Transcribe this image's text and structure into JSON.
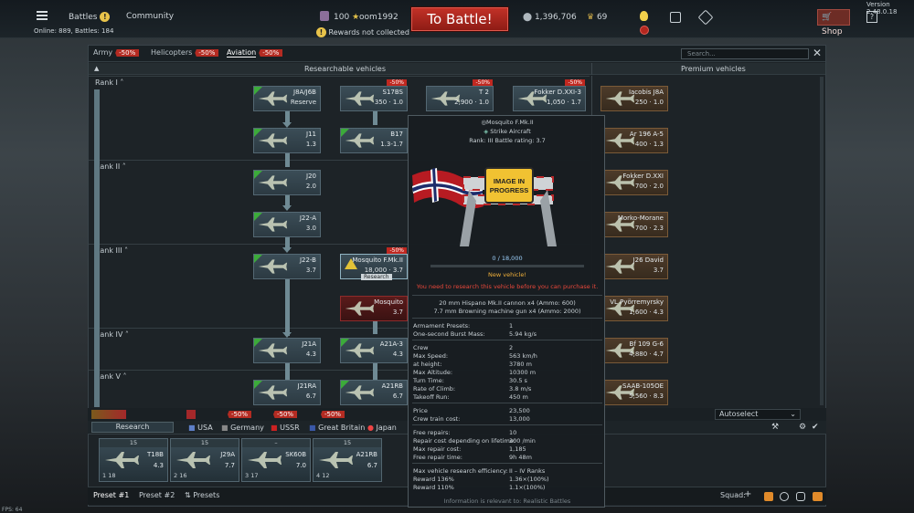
{
  "version": "Version 2.48.0.18",
  "topbar": {
    "battles": "Battles",
    "community": "Community",
    "online": "Online: 889, Battles: 184",
    "golden_eagles": "100",
    "username": "oom1992",
    "rewards_notice": "Rewards not collected",
    "to_battle": "To Battle!",
    "silver_lions": "1,396,706",
    "crew_level": "69",
    "shop": "Shop"
  },
  "tabs": [
    {
      "label": "Army",
      "discount": "-50%"
    },
    {
      "label": "Helicopters",
      "discount": "-50%"
    },
    {
      "label": "Aviation",
      "discount": "-50%"
    }
  ],
  "search_placeholder": "Search...",
  "section": {
    "researchable": "Researchable vehicles",
    "premium": "Premium vehicles"
  },
  "ranks": [
    "Rank I",
    "Rank II",
    "Rank III",
    "Rank IV",
    "Rank V"
  ],
  "tree": {
    "c1": [
      {
        "name": "J8A/J6B",
        "br": "Reserve"
      },
      {
        "name": "J11",
        "br": "1.3"
      },
      {
        "name": "J20",
        "br": "2.0"
      },
      {
        "name": "J22-A",
        "br": "3.0"
      },
      {
        "name": "J22-B",
        "br": "3.7"
      },
      {
        "name": "J21A",
        "br": "4.3"
      },
      {
        "name": "J21RA",
        "br": "6.7"
      }
    ],
    "c2": [
      {
        "name": "S17BS",
        "br": "350 · 1.0",
        "discount": "-50%"
      },
      {
        "name": "B17",
        "br": "1.3-1.7"
      },
      {
        "name": "Mosquito F.Mk.II",
        "br": "18,000 · 3.7",
        "discount": "-50%",
        "action": "Research"
      },
      {
        "name": "Mosquito",
        "br": "3.7"
      },
      {
        "name": "A21A-3",
        "br": "4.3"
      },
      {
        "name": "A21RB",
        "br": "6.7"
      }
    ],
    "c3": [
      {
        "name": "T 2",
        "br": "2,900 · 1.0",
        "discount": "-50%"
      },
      {
        "name": "Fokker D.XXI-3",
        "br": "1,050 · 1.7",
        "discount": "-50%"
      }
    ],
    "premium": [
      {
        "name": "Iacobis J8A",
        "br": "250 · 1.0"
      },
      {
        "name": "Ar 196 A-5",
        "br": "400 · 1.3"
      },
      {
        "name": "Fokker D.XXI",
        "br": "700 · 2.0"
      },
      {
        "name": "Morko-Morane",
        "br": "700 · 2.3"
      },
      {
        "name": "J26 David",
        "br": "3.7"
      },
      {
        "name": "VL Pyörremyrsky",
        "br": "1,600 · 4.3"
      },
      {
        "name": "Bf 109 G-6",
        "br": "4,880 · 4.7"
      },
      {
        "name": "SAAB-105OE",
        "br": "5,560 · 8.3"
      }
    ]
  },
  "tooltip": {
    "name": "Mosquito F.Mk.II",
    "role": "Strike Aircraft",
    "rank": "Rank: III",
    "battle_rating": "Battle rating: 3.7",
    "image_text": "IMAGE IN PROGRESS",
    "progress": "0 / 18,000",
    "progress_fraction": 0,
    "new_vehicle": "New vehicle!",
    "research_note": "You need to research this vehicle before you can purchase it.",
    "weapons": [
      "20 mm Hispano Mk.II cannon x4 (Ammo: 600)",
      "7.7 mm Browning machine gun x4 (Ammo: 2000)"
    ],
    "stats_a": [
      {
        "k": "Armament Presets:",
        "v": "1"
      },
      {
        "k": "One-second Burst Mass:",
        "v": "5.94 kg/s"
      }
    ],
    "stats_b": [
      {
        "k": "Crew",
        "v": "2"
      },
      {
        "k": "Max Speed:",
        "v": "563 km/h"
      },
      {
        "k": "at height:",
        "v": "3780 m"
      },
      {
        "k": "Max Altitude:",
        "v": "10300 m"
      },
      {
        "k": "Turn Time:",
        "v": "30.5 s"
      },
      {
        "k": "Rate of Climb:",
        "v": "3.8 m/s"
      },
      {
        "k": "Takeoff Run:",
        "v": "450 m"
      }
    ],
    "stats_c": [
      {
        "k": "Price",
        "v": "23,500"
      },
      {
        "k": "Crew train cost:",
        "v": "13,000"
      }
    ],
    "stats_d": [
      {
        "k": "Free repairs:",
        "v": "10"
      },
      {
        "k": "Repair cost depending on lifetime:",
        "v": "300 /min"
      },
      {
        "k": "Max repair cost:",
        "v": "1,185"
      },
      {
        "k": "Free repair time:",
        "v": "9h 48m"
      }
    ],
    "stats_e": [
      {
        "k": "Max vehicle research efficiency:",
        "v": "II – IV Ranks"
      },
      {
        "k": "Reward 136%",
        "v": "1.36×(100%)"
      },
      {
        "k": "Reward 110%",
        "v": "1.1×(100%)"
      }
    ],
    "footer": "Information is relevant to: Realistic Battles"
  },
  "research_tab": "Research",
  "nations": [
    {
      "label": "USA",
      "discount": ""
    },
    {
      "label": "Germany",
      "discount": "-50%"
    },
    {
      "label": "USSR",
      "discount": "-50%"
    },
    {
      "label": "Great Britain",
      "discount": "-50%"
    },
    {
      "label": "Japan",
      "discount": ""
    }
  ],
  "autoselect": "Autoselect",
  "slots": [
    {
      "hdr": "15",
      "name": "T18B",
      "br": "4.3",
      "foot": "1   18"
    },
    {
      "hdr": "15",
      "name": "J29A",
      "br": "7.7",
      "foot": "2   16"
    },
    {
      "hdr": "–",
      "name": "SK60B",
      "br": "7.0",
      "foot": "3   17"
    },
    {
      "hdr": "15",
      "name": "A21RB",
      "br": "6.7",
      "foot": "4   12"
    }
  ],
  "footer": {
    "preset1": "Preset #1",
    "preset2": "Preset #2",
    "presets": "Presets",
    "squad": "Squad:"
  },
  "fps": "FPS: 64"
}
